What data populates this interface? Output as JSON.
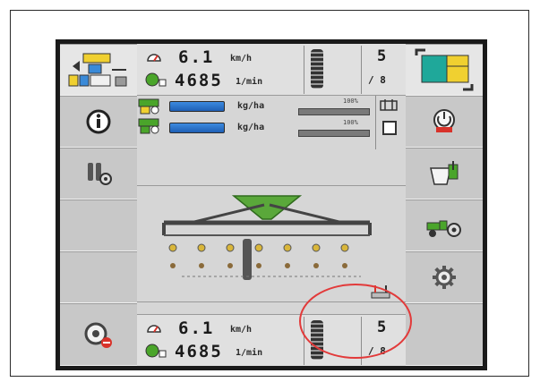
{
  "top_bar": {
    "speed": "6.1",
    "speed_unit": "km/h",
    "rpm": "4685",
    "rpm_unit": "1/min",
    "section_count": "5",
    "section_total": "/ 8"
  },
  "rates": [
    {
      "unit": "kg/ha",
      "max_label": "100%"
    },
    {
      "unit": "kg/ha",
      "max_label": "100%"
    }
  ],
  "bottom_bar": {
    "speed": "6.1",
    "speed_unit": "km/h",
    "rpm": "4685",
    "rpm_unit": "1/min",
    "section_count": "5",
    "section_total": "/ 8"
  },
  "colors": {
    "accent_blue": "#2a74d0",
    "hopper_green": "#4aa52a",
    "callout_red": "#e23a3a",
    "warning_red": "#d8322a"
  },
  "icons": {
    "left": [
      "map-view-icon",
      "info-icon",
      "seed-settings-icon",
      "empty",
      "empty",
      "settings-alarm-icon"
    ],
    "right": [
      "field-map-icon",
      "power-icon",
      "fill-hopper-icon",
      "tractor-settings-icon",
      "gear-icon",
      "empty"
    ]
  }
}
